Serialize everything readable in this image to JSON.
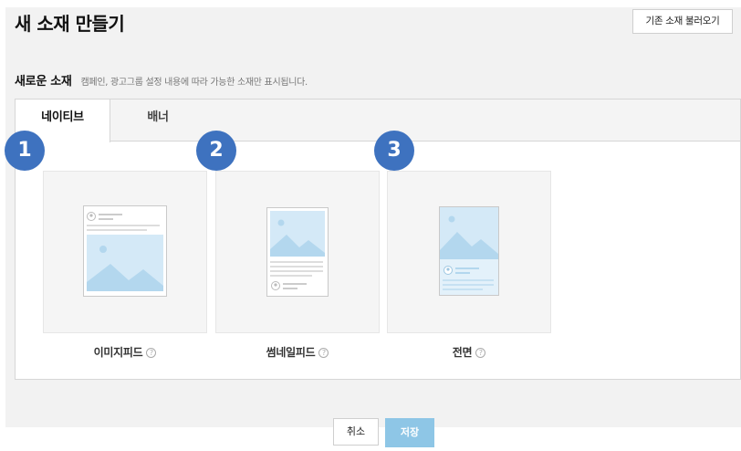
{
  "header": {
    "title": "새 소재 만들기",
    "load_button": "기존 소재 불러오기"
  },
  "section": {
    "title": "새로운 소재",
    "description": "캠페인, 광고그룹 설정 내용에 따라 가능한 소재만 표시됩니다."
  },
  "tabs": [
    {
      "label": "네이티브",
      "active": true
    },
    {
      "label": "배너",
      "active": false
    }
  ],
  "formats": [
    {
      "badge": "1",
      "label": "이미지피드",
      "icon": "image-feed-preview-icon"
    },
    {
      "badge": "2",
      "label": "썸네일피드",
      "icon": "thumbnail-feed-preview-icon"
    },
    {
      "badge": "3",
      "label": "전면",
      "icon": "fullscreen-preview-icon"
    }
  ],
  "help_glyph": "?",
  "footer": {
    "cancel": "취소",
    "save": "저장"
  },
  "colors": {
    "badge": "#3e72bf",
    "save_button": "#8ec6e6",
    "thumbnail_image": "#d4e9f7"
  }
}
